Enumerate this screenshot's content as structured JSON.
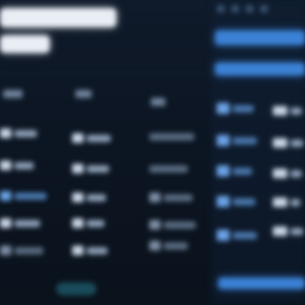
{
  "screen": {
    "note_visible_text": ""
  },
  "header": {
    "title": "",
    "subtitle": ""
  },
  "table": {
    "columns": [
      "",
      "",
      ""
    ],
    "rows": [
      [
        "",
        "",
        ""
      ],
      [
        "",
        "",
        ""
      ],
      [
        "",
        "",
        ""
      ],
      [
        "",
        "",
        ""
      ],
      [
        "",
        "",
        ""
      ]
    ]
  },
  "right_panel": {
    "tabs": [
      "",
      ""
    ],
    "rows": [
      "",
      "",
      "",
      "",
      ""
    ],
    "footer_bar": ""
  },
  "colors": {
    "background": "#0d1724",
    "accent_blue": "#3b82d6",
    "text_white": "#e9eef5"
  }
}
